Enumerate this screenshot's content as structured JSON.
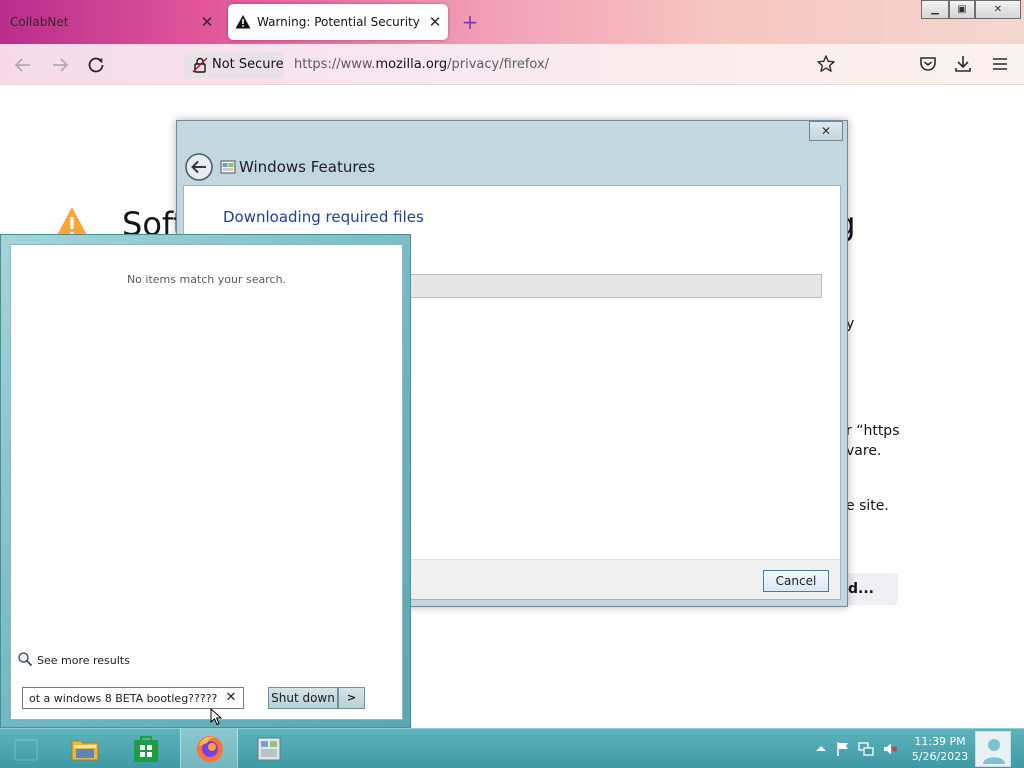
{
  "browser": {
    "tabs": [
      {
        "title": "CollabNet",
        "active": false
      },
      {
        "title": "Warning: Potential Security Risk",
        "active": true
      }
    ],
    "new_tab_symbol": "+",
    "tab_close_symbol": "✕",
    "window_controls": {
      "minimize": "▁",
      "maximize": "▣",
      "close": "✕"
    },
    "address": {
      "security_label": "Not Secure",
      "url_prefix": "https://www.",
      "url_host": "mozilla.org",
      "url_path": "/privacy/firefox/"
    }
  },
  "page": {
    "heading_start": "Soft",
    "heading_end": "ng",
    "fragments": {
      "line1": "y",
      "line2": "r “https",
      "line3": "vare.",
      "line4": "e site."
    },
    "advanced_button": "d..."
  },
  "windows_features": {
    "title": "Windows Features",
    "heading": "Downloading required files",
    "progress_fraction": 0,
    "cancel_label": "Cancel",
    "close_symbol": "✕"
  },
  "start_search": {
    "no_results": "No items match your search.",
    "see_more": "See more results",
    "query": "ot a windows 8 BETA bootleg?????",
    "clear_symbol": "✕",
    "shutdown_label": "Shut down",
    "shutdown_arrow": ">"
  },
  "taskbar": {
    "time": "11:39 PM",
    "date": "5/26/2023",
    "accent": "#4ba6b0"
  }
}
